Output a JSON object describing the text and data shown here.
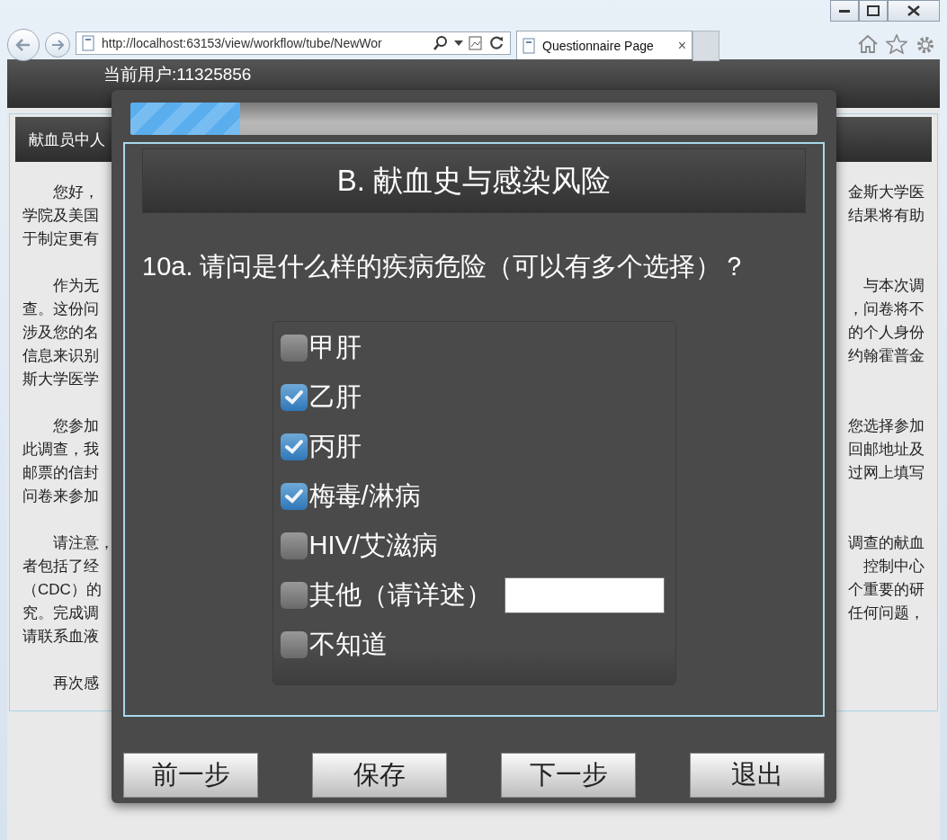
{
  "browser": {
    "address": "http://localhost:63153/view/workflow/tube/NewWor",
    "tab": {
      "title": "Questionnaire Page",
      "close": "×"
    }
  },
  "page": {
    "user_label": "当前用户:11325856",
    "panel_title": "献血员中人",
    "paragraphs": [
      {
        "lines": [
          {
            "left": "您好，",
            "right": "金斯大学医"
          },
          {
            "left": "学院及美国",
            "right": "结果将有助"
          },
          {
            "left": "于制定更有"
          }
        ]
      },
      {
        "lines": [
          {
            "left": "作为无",
            "right": "与本次调"
          },
          {
            "left": "查。这份问",
            "right": "，问卷将不"
          },
          {
            "left": "涉及您的名",
            "right": "的个人身份"
          },
          {
            "left": "信息来识别",
            "right": "约翰霍普金"
          },
          {
            "left": "斯大学医学"
          }
        ]
      },
      {
        "lines": [
          {
            "left": "您参加",
            "right": "您选择参加"
          },
          {
            "left": "此调查，我",
            "right": "回邮地址及"
          },
          {
            "left": "邮票的信封",
            "right": "过网上填写"
          },
          {
            "left": "问卷来参加"
          }
        ]
      },
      {
        "lines": [
          {
            "left": "请注意，",
            "right": "调查的献血"
          },
          {
            "left": "者包括了经",
            "right": "控制中心"
          },
          {
            "left": "（CDC）的",
            "right": "个重要的研"
          },
          {
            "left": "究。完成调",
            "right": "任何问题，"
          },
          {
            "left": "请联系血液"
          }
        ]
      },
      {
        "lines": [
          {
            "left": "再次感"
          }
        ]
      }
    ]
  },
  "dialog": {
    "progress": {
      "level": 0.16
    },
    "section_title": "B. 献血史与感染风险",
    "question": "10a. 请问是什么样的疾病危险（可以有多个选择）？",
    "options": [
      {
        "label": "甲肝",
        "checked": false,
        "kind": "plain"
      },
      {
        "label": "乙肝",
        "checked": true,
        "kind": "plain"
      },
      {
        "label": "丙肝",
        "checked": true,
        "kind": "plain"
      },
      {
        "label": "梅毒/淋病",
        "checked": true,
        "kind": "plain"
      },
      {
        "label": "HIV/艾滋病",
        "checked": false,
        "kind": "plain"
      },
      {
        "label": "其他（请详述）",
        "checked": false,
        "kind": "with_field"
      },
      {
        "label": "不知道",
        "checked": false,
        "kind": "plain"
      }
    ],
    "buttons": [
      "前一步",
      "保存",
      "下一步",
      "退出"
    ]
  }
}
